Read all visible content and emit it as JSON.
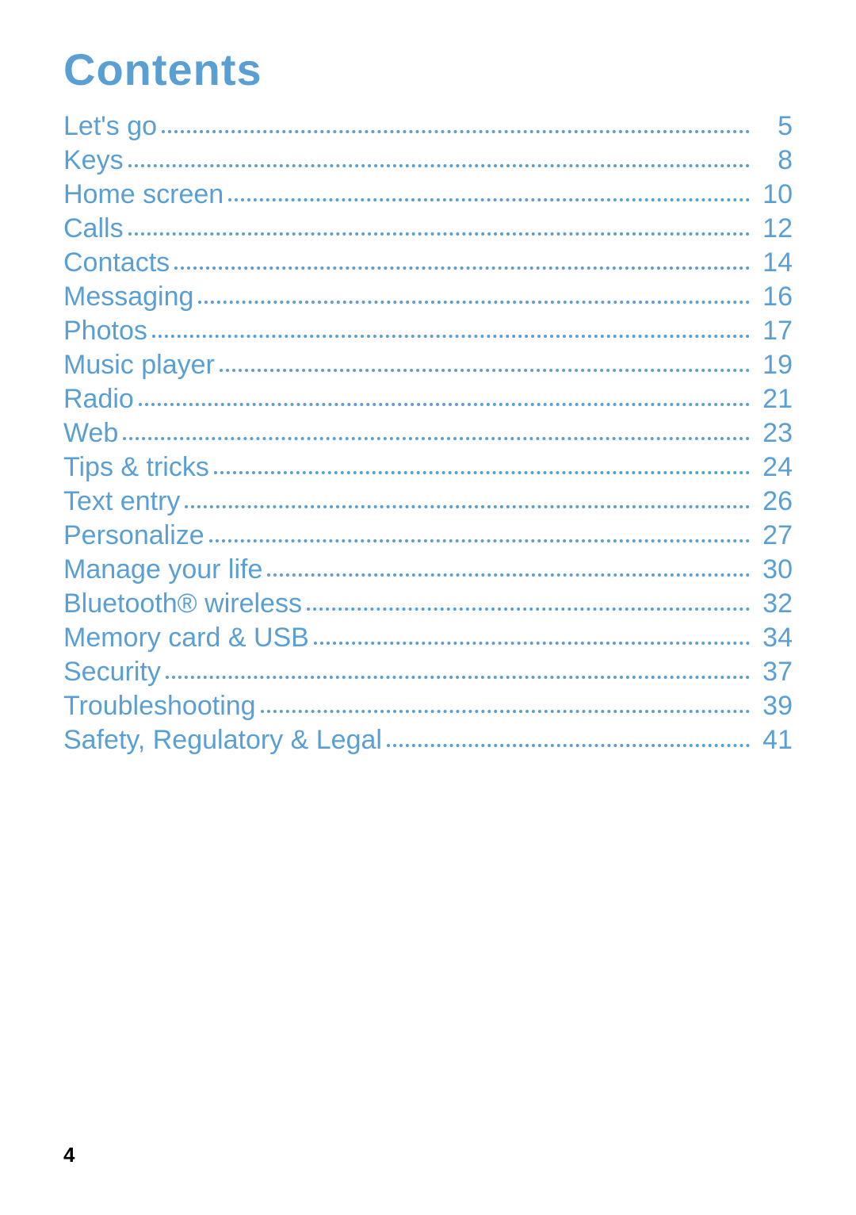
{
  "heading": "Contents",
  "page_number": "4",
  "toc": [
    {
      "title": "Let's go",
      "page": "5"
    },
    {
      "title": "Keys",
      "page": "8"
    },
    {
      "title": "Home screen",
      "page": "10"
    },
    {
      "title": "Calls",
      "page": "12"
    },
    {
      "title": "Contacts",
      "page": "14"
    },
    {
      "title": "Messaging",
      "page": "16"
    },
    {
      "title": "Photos",
      "page": "17"
    },
    {
      "title": "Music player",
      "page": "19"
    },
    {
      "title": "Radio",
      "page": "21"
    },
    {
      "title": "Web",
      "page": "23"
    },
    {
      "title": "Tips & tricks",
      "page": "24"
    },
    {
      "title": "Text entry",
      "page": "26"
    },
    {
      "title": "Personalize",
      "page": "27"
    },
    {
      "title": "Manage your life",
      "page": "30"
    },
    {
      "title": "Bluetooth® wireless",
      "page": "32"
    },
    {
      "title": "Memory card & USB",
      "page": "34"
    },
    {
      "title": "Security",
      "page": "37"
    },
    {
      "title": "Troubleshooting",
      "page": "39"
    },
    {
      "title": "Safety, Regulatory & Legal",
      "page": "41"
    }
  ]
}
